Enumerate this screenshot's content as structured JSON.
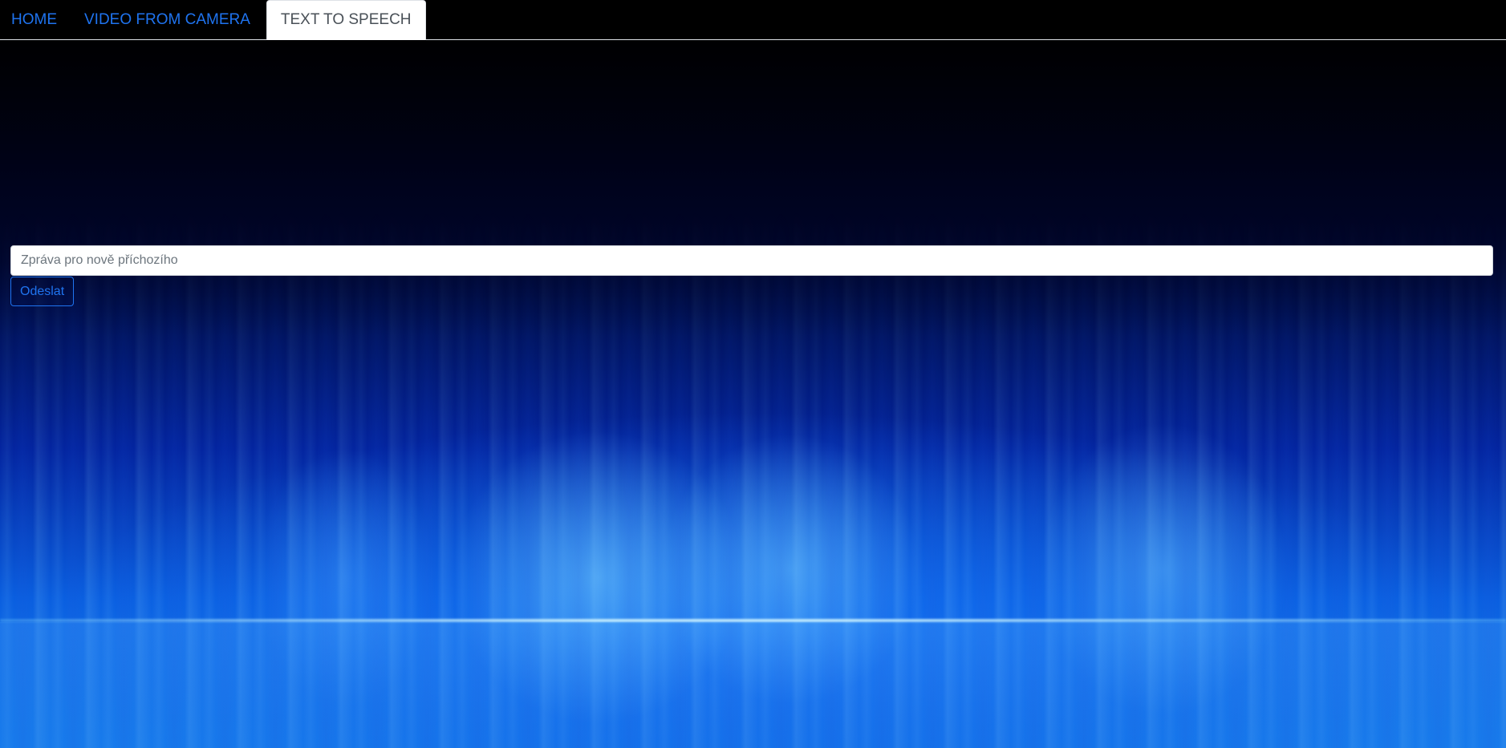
{
  "nav": {
    "items": [
      {
        "label": "HOME",
        "active": false
      },
      {
        "label": "VIDEO FROM CAMERA",
        "active": false
      },
      {
        "label": "TEXT TO SPEECH",
        "active": true
      }
    ]
  },
  "form": {
    "message_placeholder": "Zpráva pro nově příchozího",
    "message_value": "",
    "send_label": "Odeslat"
  },
  "colors": {
    "link": "#1f74f0",
    "navbar_bg": "#000000",
    "active_tab_bg": "#ffffff",
    "active_tab_text": "#495057"
  }
}
